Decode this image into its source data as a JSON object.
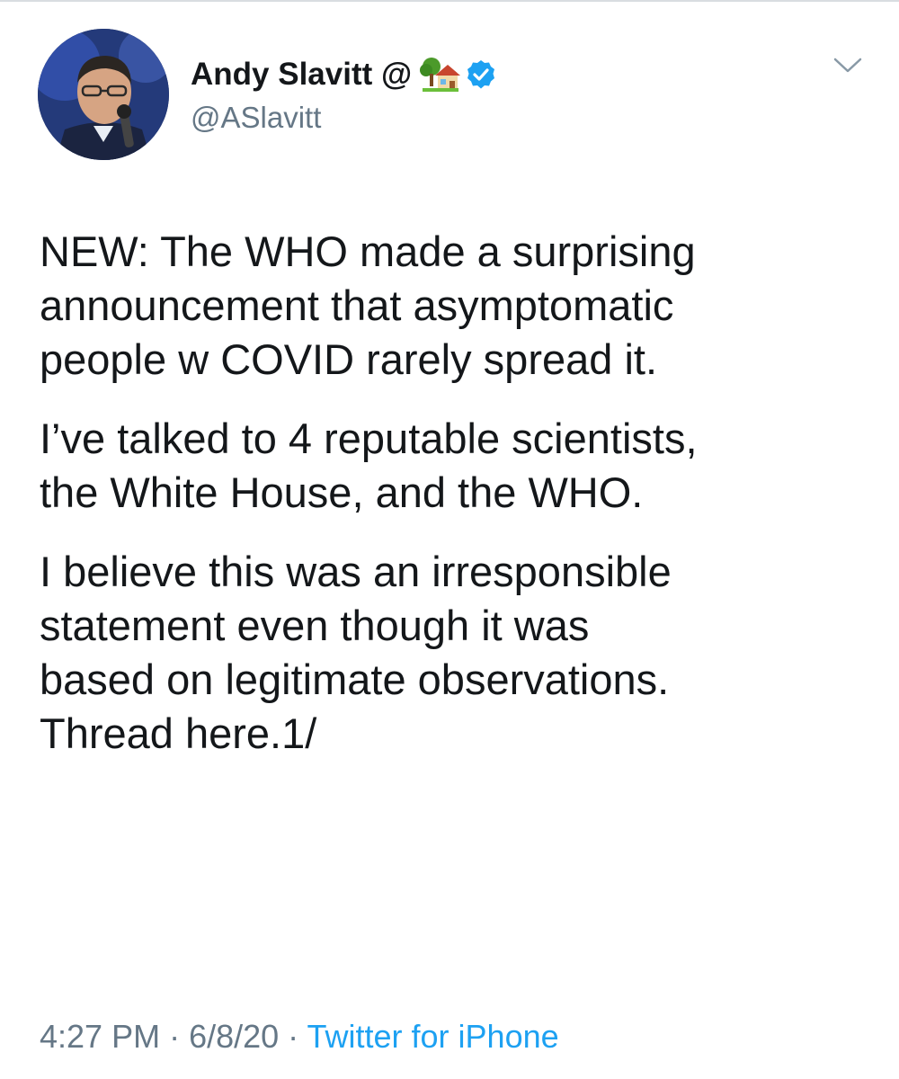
{
  "tweet": {
    "author": {
      "display_name": "Andy Slavitt @",
      "name_emoji": "house-with-tree-emoji",
      "verified": true,
      "handle": "@ASlavitt"
    },
    "paragraphs": [
      "NEW: The WHO made a surprising\nannouncement that asymptomatic\npeople w COVID rarely spread it.",
      "I’ve talked to 4 reputable scientists,\nthe White House, and the WHO.",
      "I believe this was an irresponsible\nstatement even though it was\nbased on legitimate observations.\nThread here.1/"
    ],
    "meta": {
      "time": "4:27 PM",
      "separator": " · ",
      "date": "6/8/20",
      "source": "Twitter for iPhone"
    }
  },
  "icons": {
    "more": "chevron-down-icon",
    "verified": "verified-badge-icon"
  },
  "colors": {
    "text": "#14171a",
    "secondary": "#657786",
    "link": "#1da1f2",
    "verified": "#1da1f2"
  }
}
